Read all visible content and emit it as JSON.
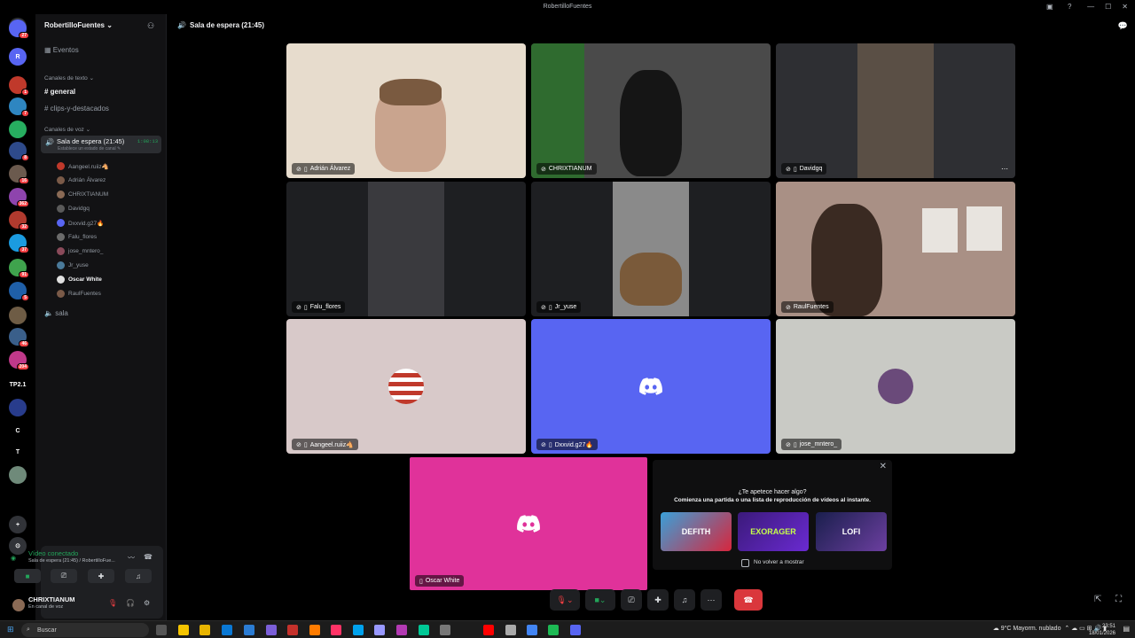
{
  "window": {
    "title": "RobertilloFuentes"
  },
  "server": {
    "name": "RobertilloFuentes",
    "events_label": "Eventos"
  },
  "text_channels": {
    "category": "Canales de texto",
    "items": [
      "general",
      "clips-y-destacados"
    ]
  },
  "voice": {
    "category": "Canales de voz",
    "active_channel": "Sala de espera (21:45)",
    "timer": "1:08:13",
    "status_placeholder": "Establece un estado de canal",
    "users": [
      "Aangeel.ruiiz🐴",
      "Adrián Álvarez",
      "CHRIXTIANUM",
      "Davidgq",
      "Dxxvid.g27🔥",
      "Falu_flores",
      "jose_mntero_",
      "Jr_yuse",
      "Oscar White",
      "RaulFuentes"
    ],
    "other_channel": "sala"
  },
  "servers": [
    {
      "badge": "27"
    },
    {
      "letter": "R"
    },
    {
      "badge": "1"
    },
    {
      "badge": "7"
    },
    {
      "badge": ""
    },
    {
      "badge": "8"
    },
    {
      "badge": "16"
    },
    {
      "badge": "362"
    },
    {
      "badge": "32"
    },
    {
      "badge": "37"
    },
    {
      "badge": "91"
    },
    {
      "badge": "5"
    },
    {
      "badge": ""
    },
    {
      "badge": "46"
    },
    {
      "badge": "204"
    },
    {
      "letter": "TP2.1"
    },
    {
      "badge": ""
    },
    {
      "letter": "C"
    },
    {
      "letter": "T"
    },
    {
      "badge": ""
    }
  ],
  "panel": {
    "status": "Vídeo conectado",
    "detail": "Sala de espera (21:45) / RobertilloFue...",
    "username": "CHRIXTIANUM",
    "user_status": "En canal de voz"
  },
  "header": {
    "title": "Sala de espera (21:45)"
  },
  "tiles": [
    {
      "name": "Adrián Álvarez",
      "bg": "#e7dccd"
    },
    {
      "name": "CHRIXTIANUM",
      "bg": "#4a4a4a"
    },
    {
      "name": "Davidgq",
      "bg": "#2e2f33"
    },
    {
      "name": "Falu_flores",
      "bg": "#1e1f22"
    },
    {
      "name": "Jr_yuse",
      "bg": "#1e1f22"
    },
    {
      "name": "RaulFuentes",
      "bg": "#a99085"
    },
    {
      "name": "Aangeel.ruiiz🐴",
      "bg": "#d8c9c9"
    },
    {
      "name": "Dxxvid.g27🔥",
      "bg": "#5865f2"
    },
    {
      "name": "jose_mntero_",
      "bg": "#c9cac5"
    }
  ],
  "self_tile": {
    "name": "Oscar White",
    "bg": "#e0329a"
  },
  "activity": {
    "title": "¿Te apetece hacer algo?",
    "subtitle": "Comienza una partida o una lista de reproducción de vídeos al instante.",
    "games": [
      "DEFITH",
      "EXORAGER",
      "LOFI"
    ],
    "dont_show": "No volver a mostrar"
  },
  "taskbar": {
    "search": "Buscar",
    "weather": "9°C  Mayorm. nublado",
    "time": "23:51",
    "date": "18/01/2026"
  }
}
